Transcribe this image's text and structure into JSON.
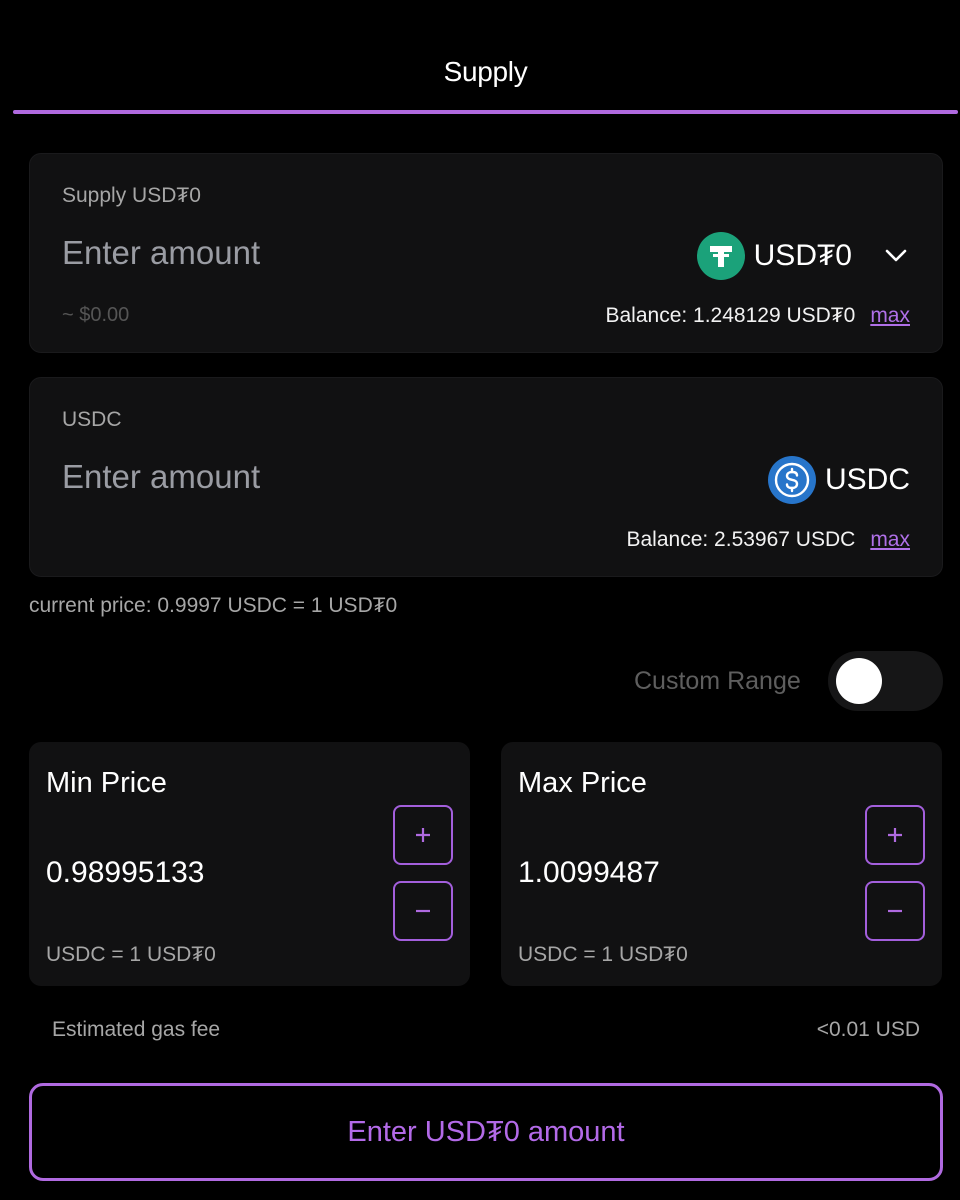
{
  "tabs": {
    "active_label": "Supply"
  },
  "supply_card": {
    "label": "Supply USD₮0",
    "amount_placeholder": "Enter amount",
    "token_name": "USD₮0",
    "token_icon": "tether-icon",
    "usd_value": "~ $0.00",
    "balance": "Balance: 1.248129 USD₮0",
    "max_label": "max"
  },
  "usdc_card": {
    "label": "USDC",
    "amount_placeholder": "Enter amount",
    "token_name": "USDC",
    "token_icon": "usdc-icon",
    "balance": "Balance: 2.53967 USDC",
    "max_label": "max"
  },
  "current_price": "current price: 0.9997 USDC = 1 USD₮0",
  "custom_range": {
    "label": "Custom Range",
    "enabled": false
  },
  "min_price": {
    "title": "Min Price",
    "value": "0.98995133",
    "unit": "USDC = 1 USD₮0"
  },
  "max_price": {
    "title": "Max Price",
    "value": "1.0099487",
    "unit": "USDC = 1 USD₮0"
  },
  "gas": {
    "label": "Estimated gas fee",
    "value": "<0.01 USD"
  },
  "cta": {
    "label": "Enter USD₮0 amount"
  },
  "colors": {
    "accent": "#b06ae0",
    "tether_green": "#1ba27a",
    "usdc_blue": "#2775ca",
    "card_bg": "#111112"
  }
}
